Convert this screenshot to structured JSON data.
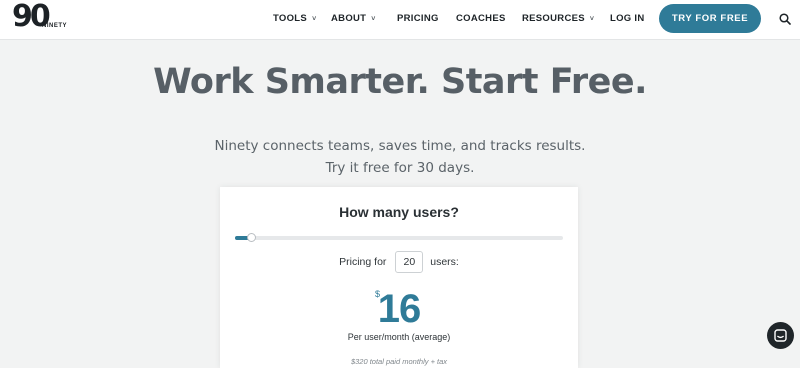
{
  "brand": {
    "logo_number": "90",
    "logo_word": "NINETY"
  },
  "nav": {
    "tools": "TOOLS",
    "about": "ABOUT",
    "pricing": "PRICING",
    "coaches": "COACHES",
    "resources": "RESOURCES",
    "login": "LOG IN",
    "cta": "TRY FOR FREE",
    "caret": "˅"
  },
  "hero": {
    "title": "Work Smarter. Start Free.",
    "subtitle_line1": "Ninety connects teams, saves time, and tracks results.",
    "subtitle_line2": "Try it free for 30 days."
  },
  "calculator": {
    "question": "How many users?",
    "slider_fraction": 0.03,
    "pricing_for": "Pricing for",
    "users_value": "20",
    "users_suffix": "users:",
    "currency": "$",
    "price": "16",
    "per_user": "Per user/month (average)",
    "total": "$320 total paid monthly + tax"
  },
  "icons": [
    "search-icon",
    "chat-icon",
    "chevron-down-icon"
  ],
  "colors": {
    "accent": "#2f7b98",
    "background": "#f2f3f3",
    "heading": "#575f66"
  }
}
